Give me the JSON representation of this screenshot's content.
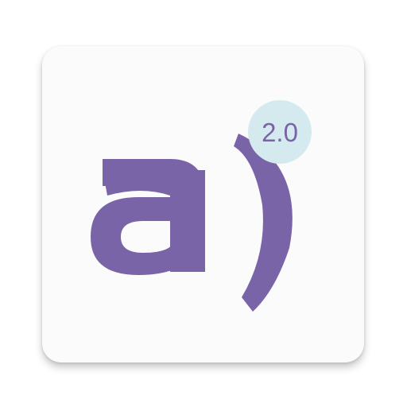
{
  "app": {
    "version_badge": "2.0",
    "icon": "ai-logo-icon"
  },
  "colors": {
    "primary_purple": "#7a64a8",
    "badge_bg": "#d4eaee",
    "card_bg": "#fbfbfb",
    "background": "#ffffff"
  }
}
